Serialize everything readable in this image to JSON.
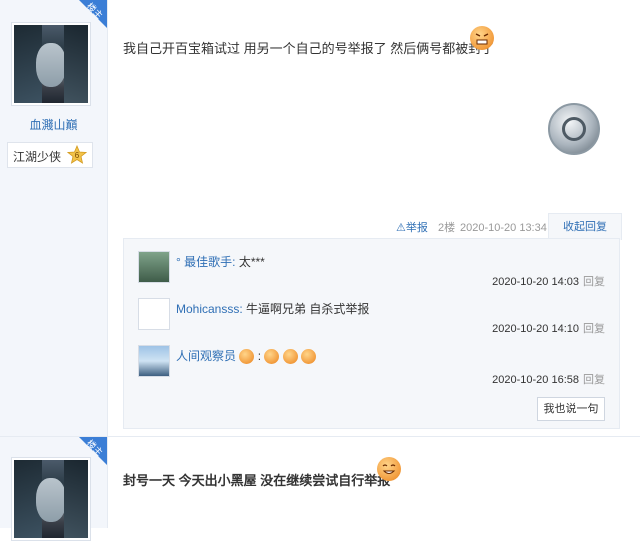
{
  "posts": [
    {
      "author": "血濺山巔",
      "badge": "楼主",
      "rank_title": "江湖少侠",
      "rank_level": "6",
      "content": "我自己开百宝箱试过 用另一个自己的号举报了 然后俩号都被封了",
      "report_label": "举报",
      "floor": "2楼",
      "timestamp": "2020-10-20 13:34",
      "collapse_label": "收起回复",
      "replies": [
        {
          "name": "° 最佳歌手:",
          "text": "太***",
          "time": "2020-10-20 14:03",
          "reply_label": "回复"
        },
        {
          "name": "Mohicansss:",
          "text": "牛逼啊兄弟 自杀式举报",
          "time": "2020-10-20 14:10",
          "reply_label": "回复"
        },
        {
          "name": "人间观察员",
          "text": ":",
          "time": "2020-10-20 16:58",
          "reply_label": "回复"
        }
      ],
      "say_button": "我也说一句"
    },
    {
      "badge": "楼主",
      "content": "封号一天 今天出小黑屋 没在继续尝试自行举报"
    }
  ],
  "colors": {
    "link": "#2f6fb5",
    "badge": "#3b7ed6",
    "sidebar": "#f3f6fb"
  }
}
